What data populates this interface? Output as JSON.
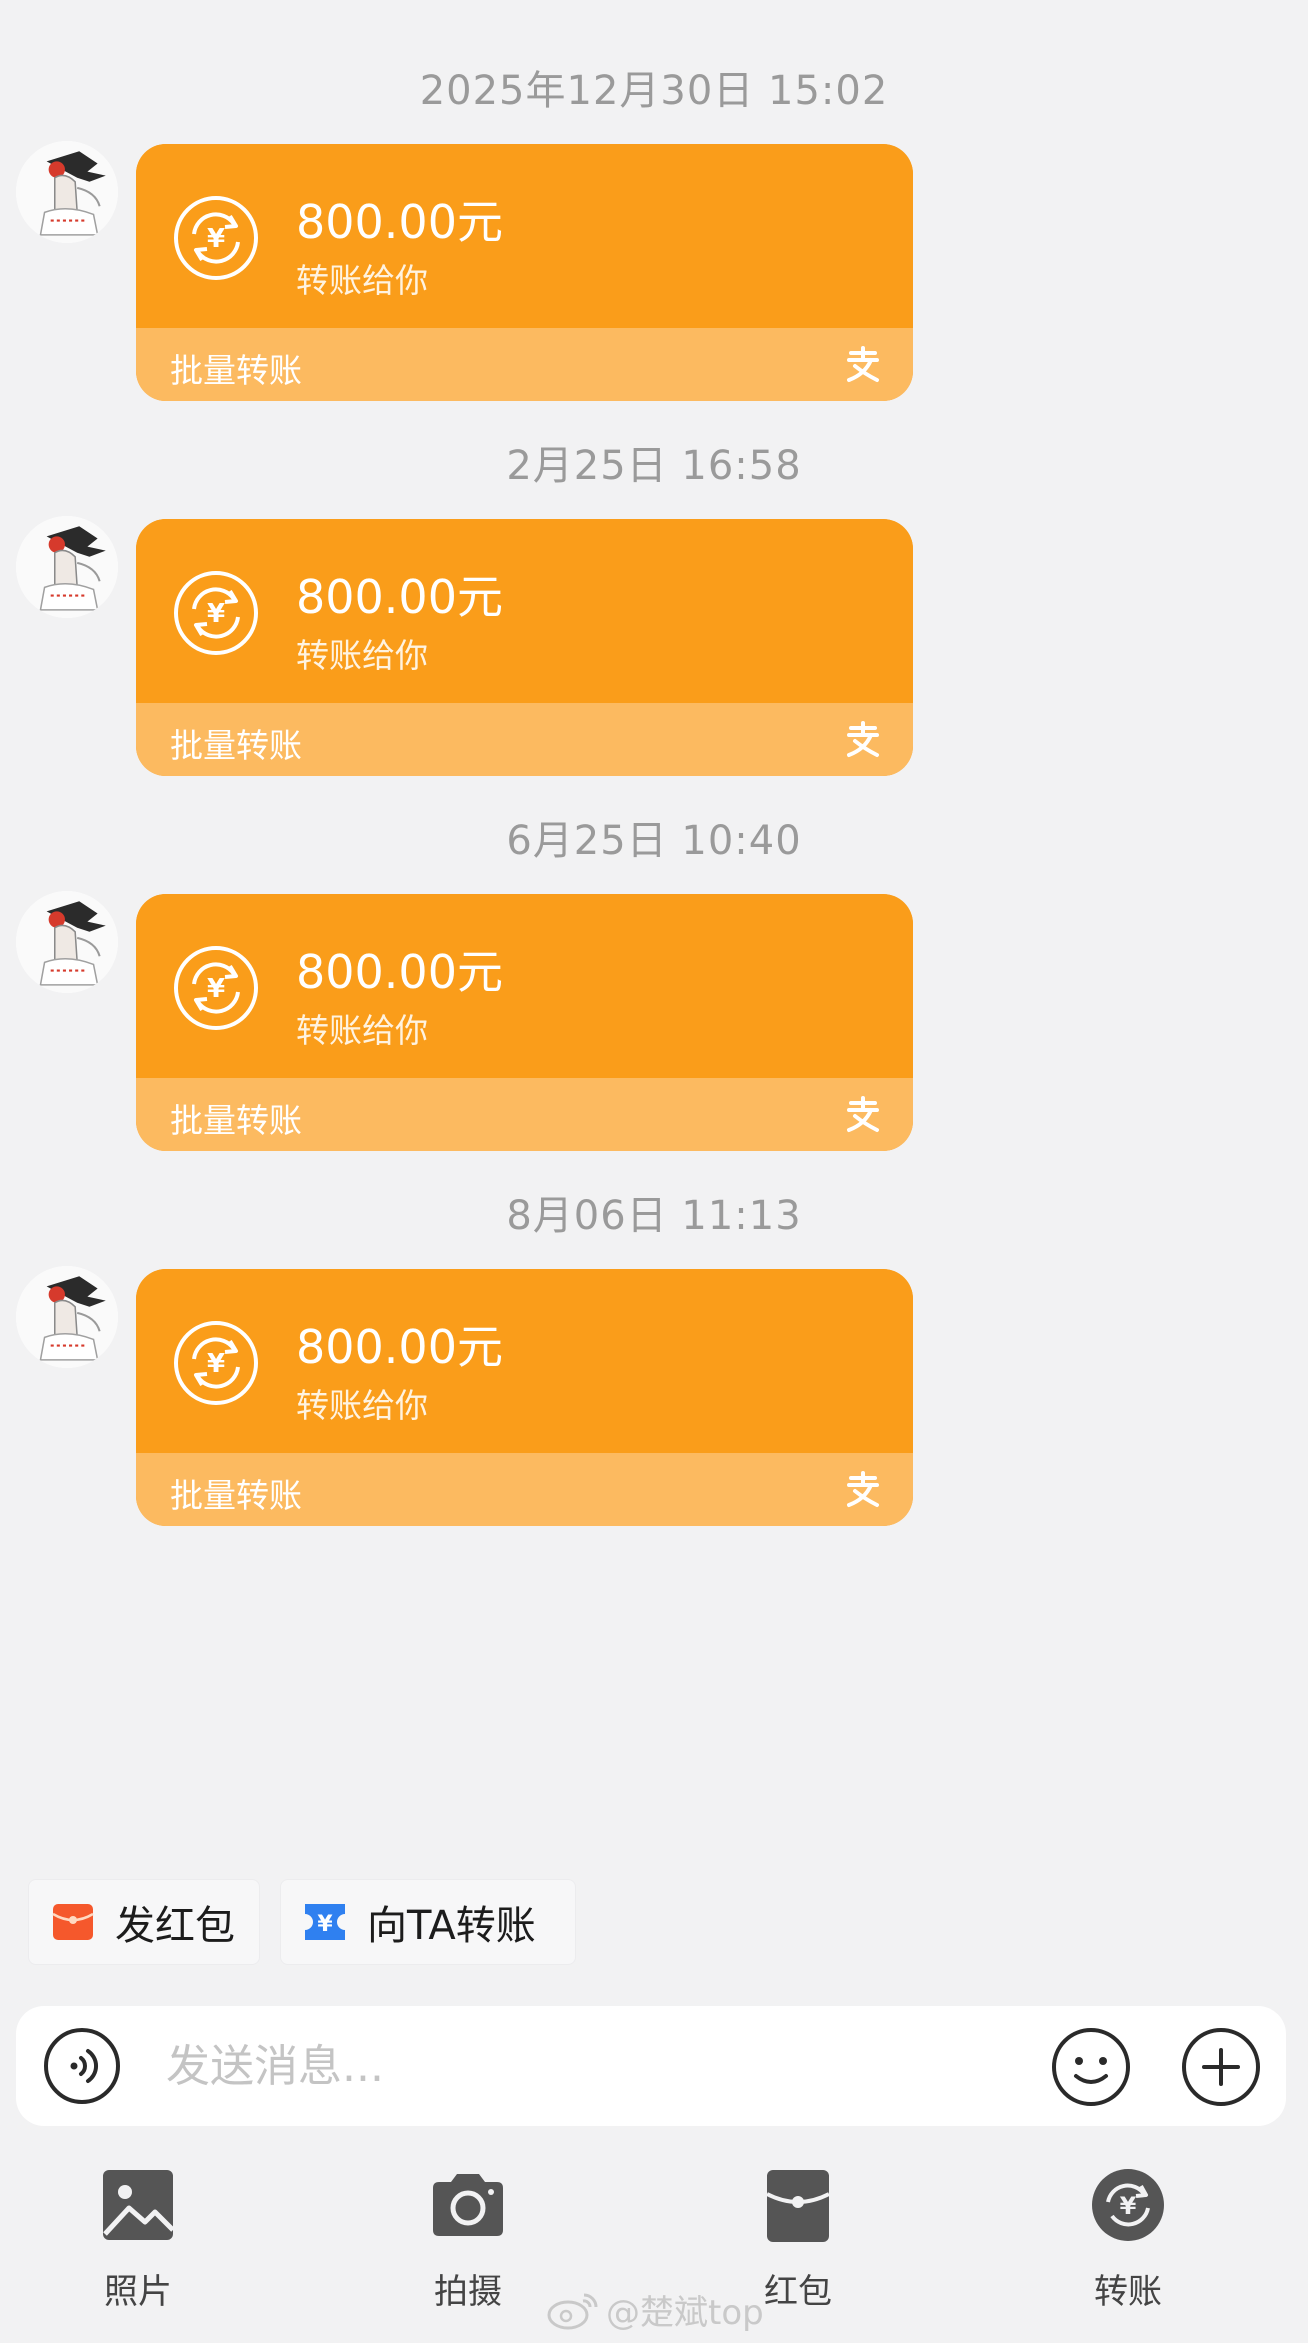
{
  "messages": [
    {
      "timestamp": "2025年12月30日 15:02",
      "amount": "800.00元",
      "subtitle": "转账给你",
      "tag": "批量转账"
    },
    {
      "timestamp": "2月25日 16:58",
      "amount": "800.00元",
      "subtitle": "转账给你",
      "tag": "批量转账"
    },
    {
      "timestamp": "6月25日 10:40",
      "amount": "800.00元",
      "subtitle": "转账给你",
      "tag": "批量转账"
    },
    {
      "timestamp": "8月06日 11:13",
      "amount": "800.00元",
      "subtitle": "转账给你",
      "tag": "批量转账"
    }
  ],
  "quick_actions": [
    {
      "label": "发红包",
      "icon": "red-envelope-icon"
    },
    {
      "label": "向TA转账",
      "icon": "transfer-ticket-icon"
    }
  ],
  "input": {
    "placeholder": "发送消息..."
  },
  "tools": [
    {
      "label": "照片",
      "icon": "photo-icon"
    },
    {
      "label": "拍摄",
      "icon": "camera-icon"
    },
    {
      "label": "红包",
      "icon": "red-packet-icon"
    },
    {
      "label": "转账",
      "icon": "transfer-icon"
    }
  ],
  "watermark": "@楚斌top",
  "colors": {
    "card_orange": "#fa9d1a",
    "card_footer": "#fcba60",
    "background": "#f2f2f3",
    "quick_red": "#f5582c",
    "quick_blue": "#2f80f0"
  }
}
